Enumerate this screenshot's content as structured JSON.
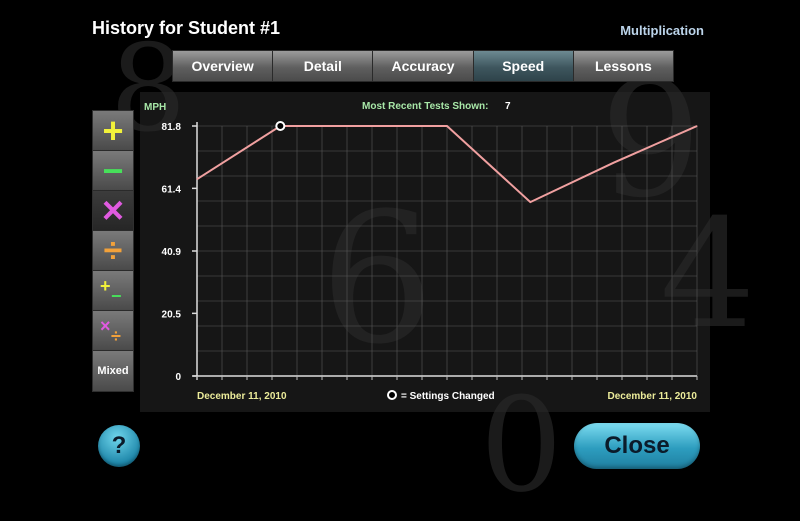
{
  "header": {
    "title": "History for Student #1",
    "subject": "Multiplication"
  },
  "tabs": [
    {
      "label": "Overview",
      "active": false
    },
    {
      "label": "Detail",
      "active": false
    },
    {
      "label": "Accuracy",
      "active": false
    },
    {
      "label": "Speed",
      "active": true
    },
    {
      "label": "Lessons",
      "active": false
    }
  ],
  "operations": [
    {
      "name": "addition",
      "symbol": "+",
      "color": "#f2f23a",
      "icon": "plus-icon"
    },
    {
      "name": "subtraction",
      "symbol": "−",
      "color": "#47e05a",
      "icon": "minus-icon"
    },
    {
      "name": "multiplication",
      "symbol": "×",
      "color": "#e05ae0",
      "icon": "multiply-icon",
      "active": true
    },
    {
      "name": "division",
      "symbol": "÷",
      "color": "#f2a13a",
      "icon": "divide-icon"
    },
    {
      "name": "add-subtract",
      "symbol": "+−",
      "icon": "add-subtract-icon"
    },
    {
      "name": "multiply-divide",
      "symbol": "×÷",
      "icon": "multiply-divide-icon"
    },
    {
      "name": "mixed",
      "label": "Mixed"
    }
  ],
  "chart": {
    "recent_label": "Most Recent Tests Shown:",
    "recent_count": "7",
    "legend_label": "= Settings Changed",
    "start_date": "December 11, 2010",
    "end_date": "December 11, 2010"
  },
  "chart_data": {
    "type": "line",
    "ylabel": "MPH",
    "yticks": [
      "0",
      "20.5",
      "40.9",
      "61.4",
      "81.8"
    ],
    "ylim": [
      0,
      81.8
    ],
    "grid": true,
    "line_color": "#f0a0a0",
    "series": [
      {
        "values": [
          64.4,
          81.8,
          81.8,
          81.8,
          56.9,
          69.8,
          81.8
        ]
      }
    ],
    "settings_changed_index": 1
  },
  "buttons": {
    "help": "?",
    "close": "Close"
  }
}
